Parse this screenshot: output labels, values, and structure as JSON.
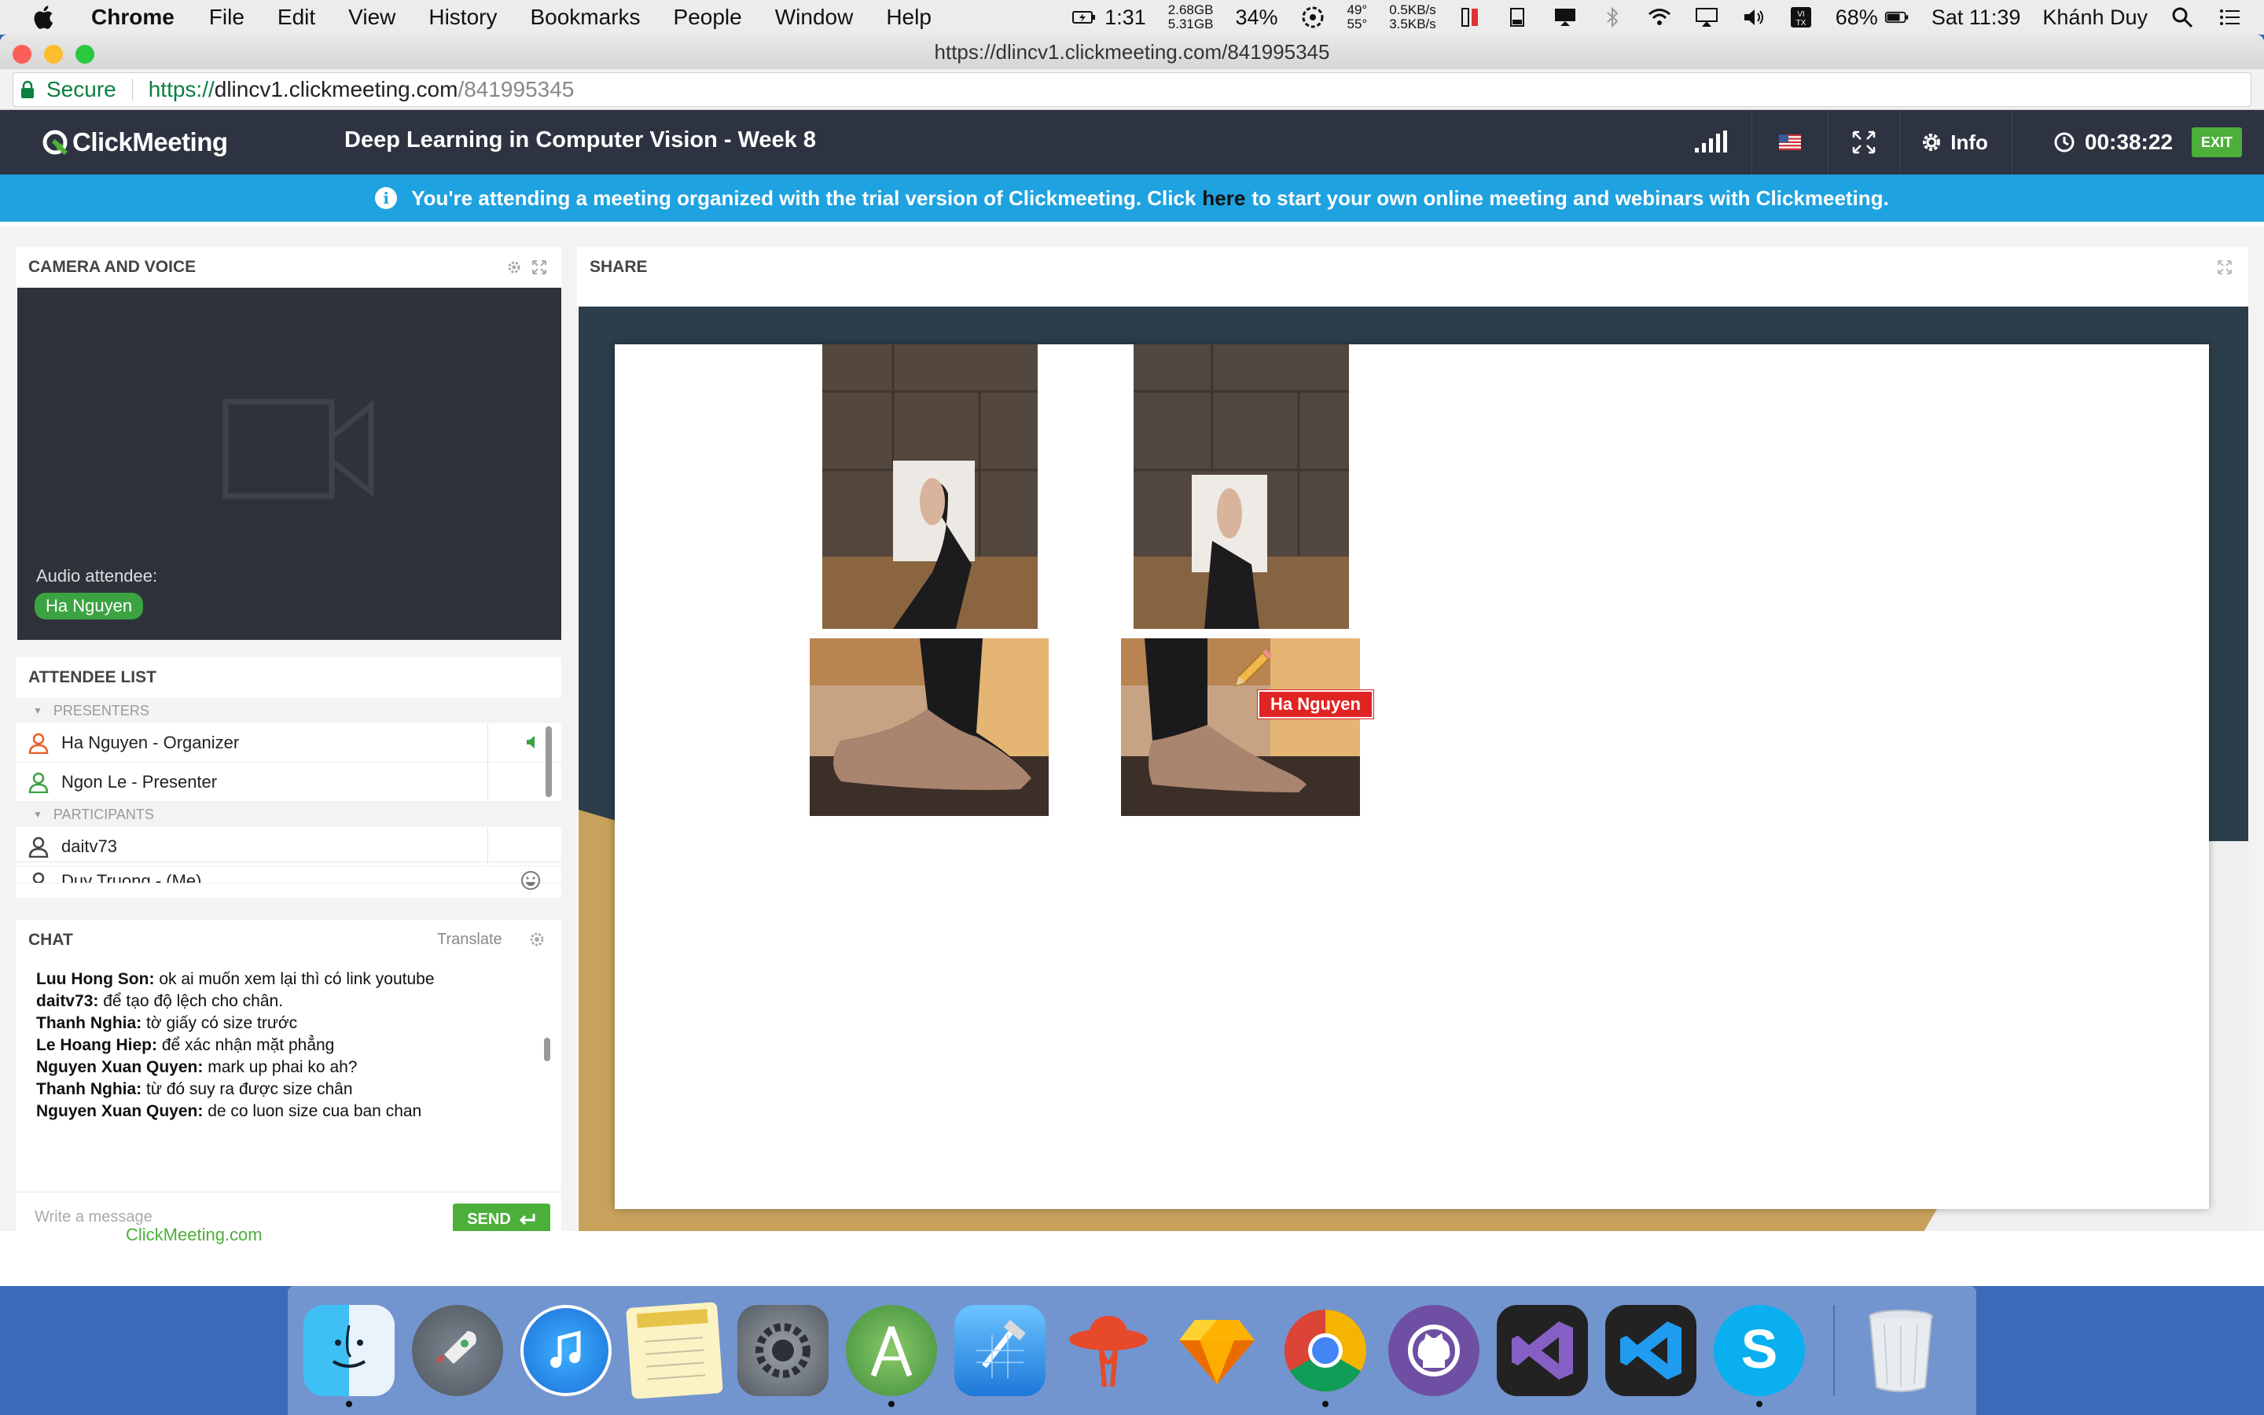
{
  "menubar": {
    "app": "Chrome",
    "items": [
      "File",
      "Edit",
      "View",
      "History",
      "Bookmarks",
      "People",
      "Window",
      "Help"
    ],
    "battery_time": "1:31",
    "mem_used": "2.68GB",
    "mem_free": "5.31GB",
    "cpu_pct": "34%",
    "temp_hi": "49°",
    "temp_lo": "55°",
    "net_up": "0.5KB/s",
    "net_down": "3.5KB/s",
    "battery_pct": "68%",
    "clock": "Sat 11:39",
    "user": "Khánh Duy"
  },
  "browser": {
    "title": "https://dlincv1.clickmeeting.com/841995345",
    "secure_label": "Secure",
    "url_scheme": "https://",
    "url_host": "dlincv1.clickmeeting.com",
    "url_path": "/841995345"
  },
  "header": {
    "logo": "ClickMeeting",
    "meeting_title": "Deep Learning in Computer Vision - Week 8",
    "info_label": "Info",
    "timer": "00:38:22",
    "exit_label": "EXIT"
  },
  "banner": {
    "text_before": "You're attending a meeting organized with the trial version of Clickmeeting. Click",
    "link": "here",
    "text_after": "to start your own online meeting and webinars with Clickmeeting."
  },
  "camera": {
    "title": "CAMERA AND VOICE",
    "audio_label": "Audio attendee:",
    "audio_name": "Ha Nguyen"
  },
  "attendees": {
    "title": "ATTENDEE LIST",
    "presenters_label": "PRESENTERS",
    "presenters": [
      "Ha Nguyen - Organizer",
      "Ngon Le - Presenter"
    ],
    "participants_label": "PARTICIPANTS",
    "participants": [
      "daitv73",
      "Duy Truong - (Me)"
    ]
  },
  "chat": {
    "title": "CHAT",
    "translate": "Translate",
    "messages": [
      {
        "who": "Luu Hong Son:",
        "text": "ok ai muốn xem lại thì có link youtube"
      },
      {
        "who": "daitv73:",
        "text": "để tạo độ lệch cho chân."
      },
      {
        "who": "Thanh Nghia:",
        "text": "tờ giấy có size trước"
      },
      {
        "who": "Le Hoang Hiep:",
        "text": "để xác nhận mặt phẳng"
      },
      {
        "who": "Nguyen Xuan Quyen:",
        "text": "mark up phai ko ah?"
      },
      {
        "who": "Thanh Nghia:",
        "text": "từ đó suy ra được size chân"
      },
      {
        "who": "Nguyen Xuan Quyen:",
        "text": "de co luon size cua ban chan"
      }
    ],
    "placeholder": "Write a message",
    "send_label": "SEND"
  },
  "share": {
    "title": "SHARE",
    "cursor_name": "Ha Nguyen"
  },
  "footer": {
    "brand": "ClickMeeting.com"
  },
  "dock": {
    "apps": [
      "finder",
      "launchpad",
      "itunes",
      "notes",
      "system-preferences",
      "android-studio",
      "xcode",
      "app-red-hat",
      "sketch",
      "chrome",
      "github-desktop",
      "visual-studio",
      "visual-studio-code",
      "skype",
      "trash"
    ]
  },
  "colors": {
    "header_bg": "#2d3340",
    "banner_bg": "#1fa2e0",
    "accent_green": "#4caf3a",
    "cursor_red": "#e02424"
  }
}
